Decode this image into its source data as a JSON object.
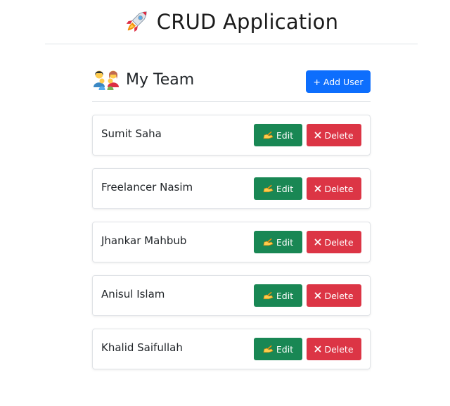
{
  "header": {
    "title": "CRUD Application",
    "icon": "rocket-icon"
  },
  "section": {
    "title": "My Team",
    "icon": "family-icon",
    "add_button_label": "+ Add User"
  },
  "users": [
    {
      "name": "Sumit Saha"
    },
    {
      "name": "Freelancer Nasim"
    },
    {
      "name": "Jhankar Mahbub"
    },
    {
      "name": "Anisul Islam"
    },
    {
      "name": "Khalid Saifullah"
    }
  ],
  "actions": {
    "edit_label": "Edit",
    "delete_label": "Delete"
  },
  "colors": {
    "primary": "#0d6efd",
    "success": "#198754",
    "danger": "#dc3545"
  }
}
